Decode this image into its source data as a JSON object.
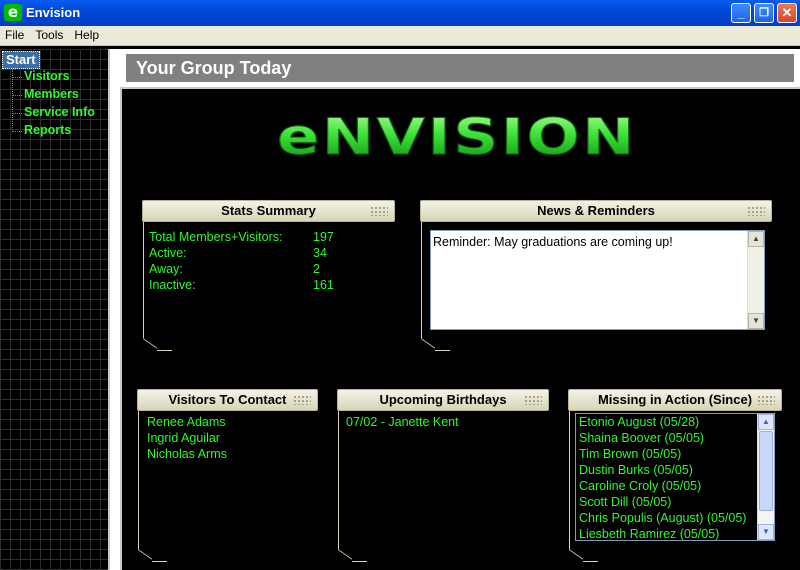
{
  "window": {
    "title": "Envision",
    "app_icon_glyph": "e",
    "controls": {
      "minimize": "_",
      "maximize": "❐",
      "close": "✕"
    }
  },
  "menu": [
    "File",
    "Tools",
    "Help"
  ],
  "sidebar": {
    "start": "Start",
    "items": [
      {
        "label": "Visitors"
      },
      {
        "label": "Members"
      },
      {
        "label": "Service Info"
      },
      {
        "label": "Reports"
      }
    ]
  },
  "header": {
    "title": "Your Group Today"
  },
  "logo": {
    "text": "eNVISION"
  },
  "stats": {
    "title": "Stats Summary",
    "rows": [
      {
        "label": "Total Members+Visitors:",
        "value": "197"
      },
      {
        "label": "Active:",
        "value": "34"
      },
      {
        "label": "Away:",
        "value": "2"
      },
      {
        "label": "Inactive:",
        "value": "161"
      }
    ]
  },
  "news": {
    "title": "News & Reminders",
    "text": "Reminder: May graduations are coming up!"
  },
  "visitors": {
    "title": "Visitors To Contact",
    "items": [
      "Renee Adams",
      "Ingrid Aguilar",
      "Nicholas Arms"
    ]
  },
  "birthdays": {
    "title": "Upcoming Birthdays",
    "items": [
      "07/02 - Janette Kent"
    ]
  },
  "mia": {
    "title": "Missing in Action (Since)",
    "items": [
      "Etonio August  (05/28)",
      "Shaina Boover  (05/05)",
      "Tim Brown  (05/05)",
      "Dustin Burks  (05/05)",
      "Caroline Croly  (05/05)",
      "Scott Dill  (05/05)",
      "Chris Populis (August)  (05/05)",
      "Liesbeth Ramirez  (05/05)"
    ]
  },
  "colors": {
    "accent_green": "#2ef72e",
    "title_bar": "#0a5cf0",
    "panel_header": "#ece9d8"
  }
}
